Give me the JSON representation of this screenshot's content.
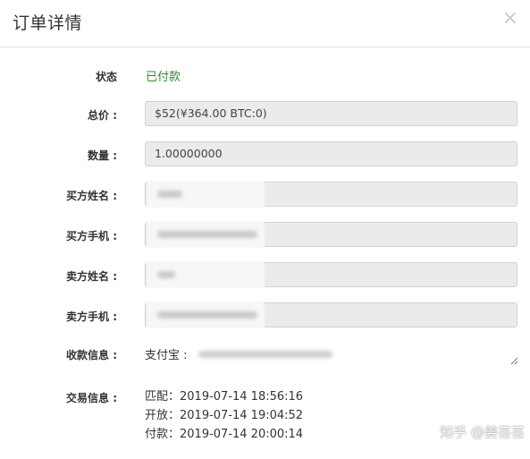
{
  "modal": {
    "title": "订单详情",
    "close_icon": "close-icon",
    "close_glyph": "×"
  },
  "fields": {
    "status": {
      "label": "状态",
      "value": "已付款",
      "color": "#2f8b32"
    },
    "total_price": {
      "label": "总价 :",
      "value": "$52(¥364.00  BTC:0)"
    },
    "quantity": {
      "label": "数量 :",
      "value": "1.00000000"
    },
    "buyer_name": {
      "label": "买方姓名 :",
      "value": ""
    },
    "buyer_phone": {
      "label": "买方手机 :",
      "value": ""
    },
    "seller_name": {
      "label": "卖方姓名 :",
      "value": ""
    },
    "seller_phone": {
      "label": "卖方手机 :",
      "value": ""
    },
    "payment_info": {
      "label": "收款信息 :",
      "value_prefix": "支付宝 :"
    },
    "trade_info": {
      "label": "交易信息 :",
      "lines": [
        "匹配：2019-07-14 18:56:16",
        "开放：2019-07-14 19:04:52",
        "付款：2019-07-14 20:00:14"
      ]
    }
  },
  "watermark": "知乎 @姜芸芸"
}
